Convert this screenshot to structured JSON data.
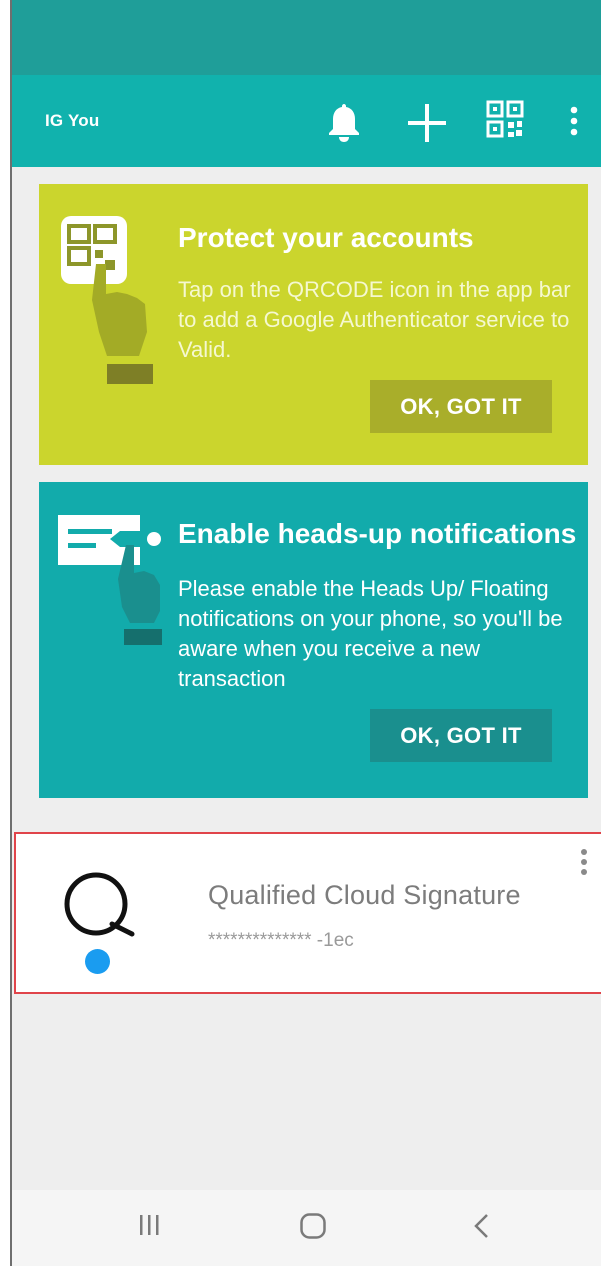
{
  "app_bar": {
    "title": "IG You",
    "icons": [
      "bell-icon",
      "plus-icon",
      "qr-code-icon",
      "overflow-menu-icon"
    ]
  },
  "cards": [
    {
      "title": "Protect your accounts",
      "body": "Tap on the QRCODE icon in the app bar to add a Google Authenticator service to Valid.",
      "button": "OK, GOT IT",
      "color": "#cbd52d"
    },
    {
      "title": "Enable heads-up notifications",
      "body": "Please enable the Heads Up/ Floating notifications on your phone, so you'll be aware when you receive a new transaction",
      "button": "OK, GOT IT",
      "color": "#12abab"
    }
  ],
  "account": {
    "name": "Qualified Cloud Signature",
    "masked_id": "************** -1ec",
    "status_color": "#1a9cf0"
  },
  "nav": [
    "recents-icon",
    "home-icon",
    "back-icon"
  ],
  "colors": {
    "status_bar": "#1f9e99",
    "app_bar": "#11b2ad",
    "highlight_border": "#e0444a"
  }
}
